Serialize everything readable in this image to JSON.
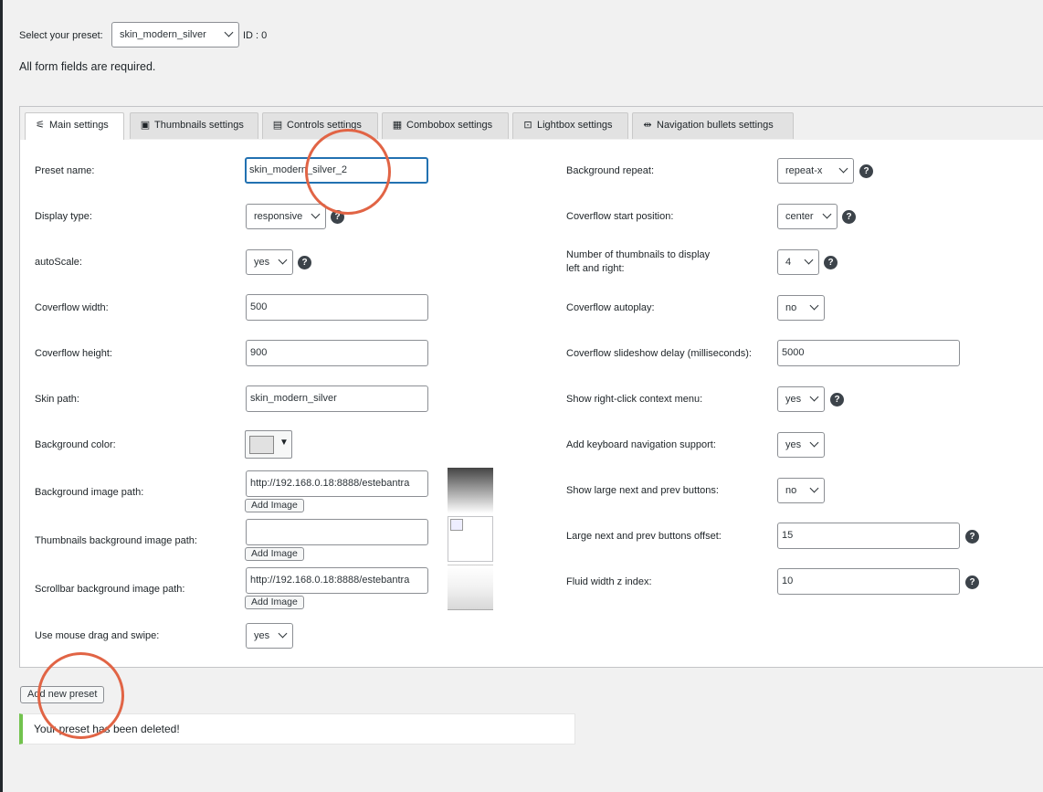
{
  "top": {
    "select_label": "Select your preset:",
    "preset_value": "skin_modern_silver",
    "id_text": "ID : 0",
    "required_note": "All form fields are required."
  },
  "tabs": [
    {
      "label": "Main settings",
      "icon": "sliders-icon"
    },
    {
      "label": "Thumbnails settings",
      "icon": "thumbnails-icon"
    },
    {
      "label": "Controls settings",
      "icon": "controls-icon"
    },
    {
      "label": "Combobox settings",
      "icon": "combobox-icon"
    },
    {
      "label": "Lightbox settings",
      "icon": "lightbox-icon"
    },
    {
      "label": "Navigation bullets settings",
      "icon": "bullets-icon"
    }
  ],
  "left": {
    "preset_name": {
      "label": "Preset name:",
      "value": "skin_modern_silver_2"
    },
    "display_type": {
      "label": "Display type:",
      "value": "responsive"
    },
    "auto_scale": {
      "label": "autoScale:",
      "value": "yes"
    },
    "coverflow_width": {
      "label": "Coverflow width:",
      "value": "500"
    },
    "coverflow_height": {
      "label": "Coverflow height:",
      "value": "900"
    },
    "skin_path": {
      "label": "Skin path:",
      "value": "skin_modern_silver"
    },
    "background_color": {
      "label": "Background color:",
      "value": "#e1e1e1"
    },
    "background_image": {
      "label": "Background image path:",
      "value": "http://192.168.0.18:8888/estebantra",
      "button": "Add Image"
    },
    "thumbs_bg_image": {
      "label": "Thumbnails background image path:",
      "value": "",
      "button": "Add Image"
    },
    "scrollbar_bg_image": {
      "label": "Scrollbar background image path:",
      "value": "http://192.168.0.18:8888/estebantra",
      "button": "Add Image"
    },
    "mouse_drag": {
      "label": "Use mouse drag and swipe:",
      "value": "yes"
    }
  },
  "right": {
    "bg_repeat": {
      "label": "Background repeat:",
      "value": "repeat-x"
    },
    "start_position": {
      "label": "Coverflow start position:",
      "value": "center"
    },
    "num_thumbs": {
      "label_line1": "Number of thumbnails to display",
      "label_line2": "left and right:",
      "value": "4"
    },
    "autoplay": {
      "label": "Coverflow autoplay:",
      "value": "no"
    },
    "slideshow_delay": {
      "label": "Coverflow slideshow delay (milliseconds):",
      "value": "5000"
    },
    "context_menu": {
      "label": "Show right-click context menu:",
      "value": "yes"
    },
    "keyboard_nav": {
      "label": "Add keyboard navigation support:",
      "value": "yes"
    },
    "large_buttons": {
      "label": "Show large next and prev buttons:",
      "value": "no"
    },
    "buttons_offset": {
      "label": "Large next and prev buttons offset:",
      "value": "15"
    },
    "fluid_z": {
      "label": "Fluid width z index:",
      "value": "10"
    }
  },
  "help_glyph": "?",
  "add_preset_label": "Add new preset",
  "notice_text": "Your preset has been deleted!",
  "colors": {
    "accent_circle": "#e16445",
    "notice_border": "#72c34e",
    "focus_border": "#2271b1"
  }
}
